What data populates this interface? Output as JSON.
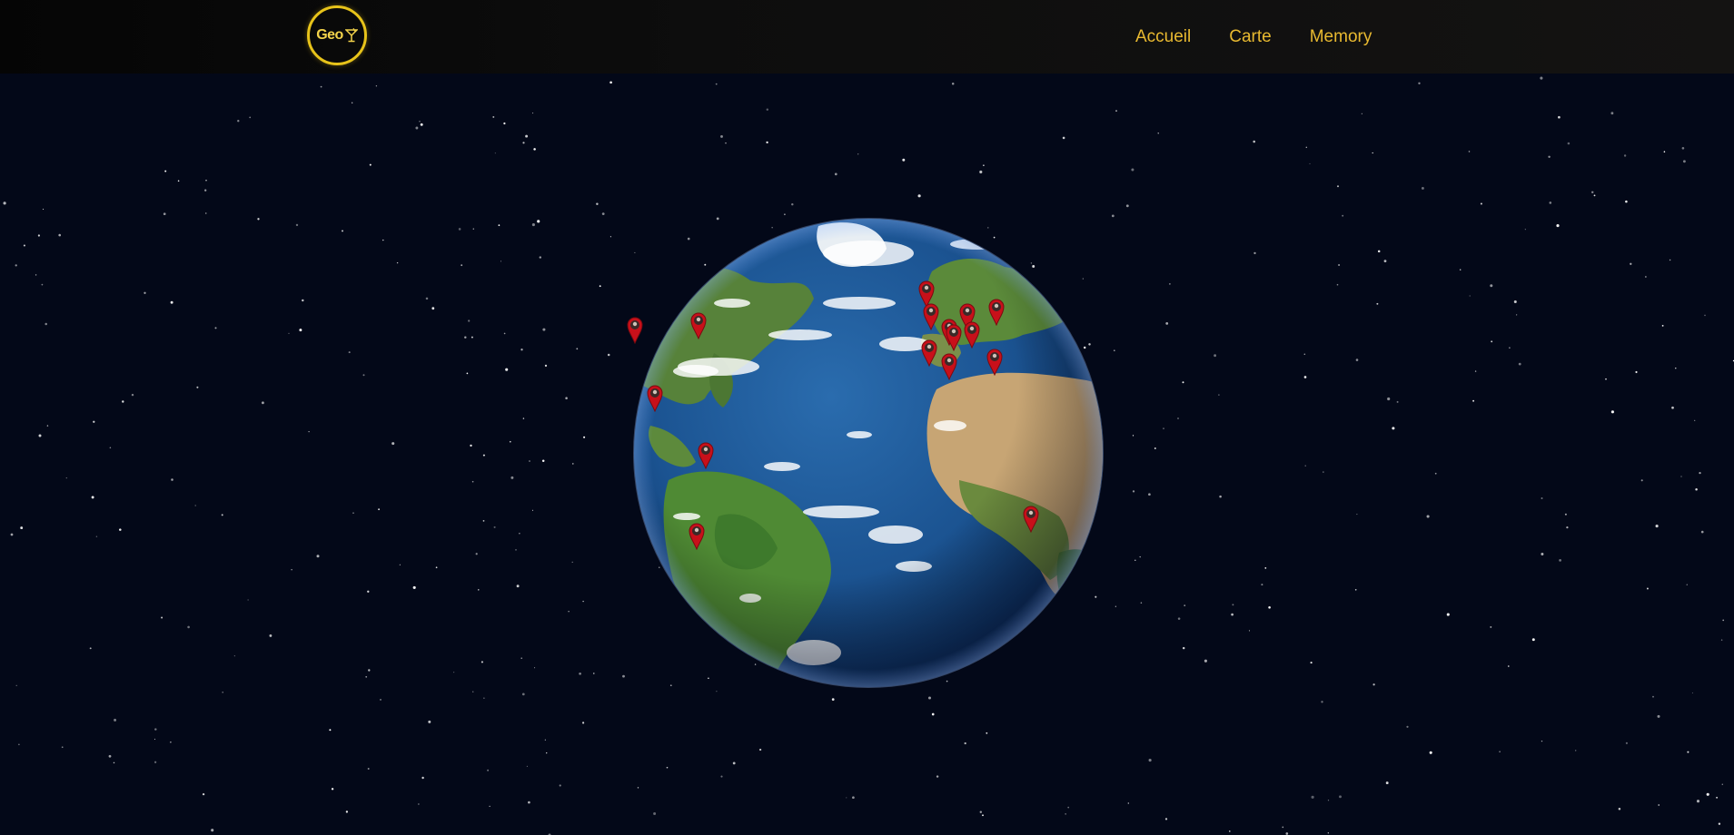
{
  "brand": {
    "logo_text": "Geo",
    "logo_icon": "cocktail-glass-icon",
    "accent_color": "#e7c31a"
  },
  "nav": {
    "items": [
      {
        "label": "Accueil"
      },
      {
        "label": "Carte"
      },
      {
        "label": "Memory"
      }
    ],
    "text_color": "#e8b930"
  },
  "scene": {
    "background_color": "#030818",
    "globe": {
      "ocean_color": "#1d5a9a",
      "land_color": "#5c8a3a",
      "desert_color": "#c9a675"
    },
    "markers": [
      {
        "name": "marker-1",
        "icon": "map-pin-icon",
        "color": "#c8101a"
      },
      {
        "name": "marker-2",
        "icon": "map-pin-icon",
        "color": "#c8101a"
      },
      {
        "name": "marker-3",
        "icon": "map-pin-icon",
        "color": "#c8101a"
      },
      {
        "name": "marker-4",
        "icon": "map-pin-icon",
        "color": "#c8101a"
      },
      {
        "name": "marker-5",
        "icon": "map-pin-icon",
        "color": "#c8101a"
      },
      {
        "name": "marker-6",
        "icon": "map-pin-icon",
        "color": "#c8101a"
      },
      {
        "name": "marker-7",
        "icon": "map-pin-icon",
        "color": "#c8101a"
      },
      {
        "name": "marker-8",
        "icon": "map-pin-icon",
        "color": "#c8101a"
      },
      {
        "name": "marker-9",
        "icon": "map-pin-icon",
        "color": "#c8101a"
      },
      {
        "name": "marker-10",
        "icon": "map-pin-icon",
        "color": "#c8101a"
      },
      {
        "name": "marker-11",
        "icon": "map-pin-icon",
        "color": "#c8101a"
      },
      {
        "name": "marker-12",
        "icon": "map-pin-icon",
        "color": "#c8101a"
      },
      {
        "name": "marker-13",
        "icon": "map-pin-icon",
        "color": "#c8101a"
      },
      {
        "name": "marker-14",
        "icon": "map-pin-icon",
        "color": "#c8101a"
      },
      {
        "name": "marker-15",
        "icon": "map-pin-icon",
        "color": "#c8101a"
      },
      {
        "name": "marker-16",
        "icon": "map-pin-icon",
        "color": "#c8101a"
      }
    ]
  }
}
